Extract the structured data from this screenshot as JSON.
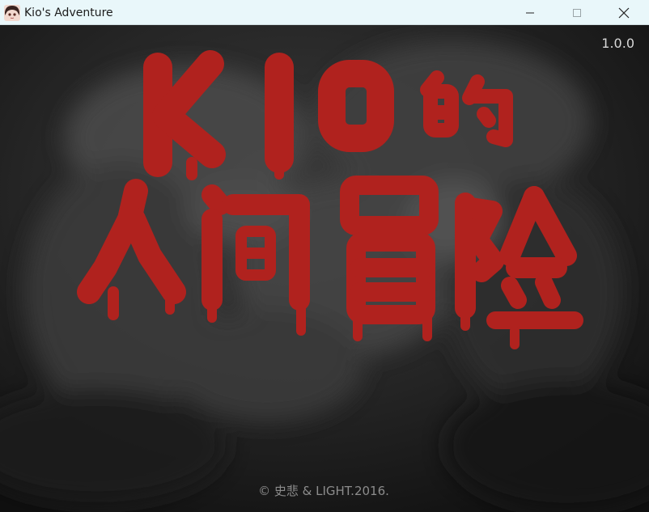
{
  "window": {
    "title": "Kio's Adventure",
    "controls": {
      "minimize_icon": "minimize-icon",
      "maximize_icon": "maximize-icon",
      "close_icon": "close-icon"
    },
    "titlebar_color": "#e9f7fa"
  },
  "game": {
    "version": "1.0.0",
    "logo": {
      "latin": "KIO",
      "chinese_small": "的",
      "chinese_main": "人间冒险",
      "color": "#b0221e"
    },
    "copyright": "© 史悲 & LIGHT.2016."
  }
}
